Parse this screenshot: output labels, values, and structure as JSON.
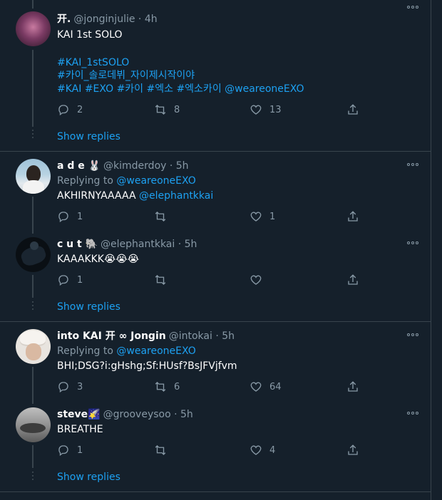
{
  "colors": {
    "background": "#15202b",
    "link": "#1da1f2",
    "muted": "#8899a6",
    "border": "#38444d"
  },
  "tweets": [
    {
      "name": "开.",
      "handle": "@jonginjulie",
      "time": "· 4h",
      "lines": [
        "KAI 1st SOLO",
        "#KAI_1stSOLO",
        "#카이_솔로데뷔_자이제시작이야",
        "#KAI #EXO #카이 #엑소 #엑소카이 @weareoneEXO"
      ],
      "replies": "2",
      "retweets": "8",
      "likes": "13"
    },
    {
      "name": "a d e 🐰",
      "handle": "@kimderdoy",
      "time": "· 5h",
      "replying_label": "Replying to",
      "replying_to": "@weareoneEXO",
      "text": "AKHIRNYAAAAA",
      "mention": "@elephantkkai",
      "replies": "1",
      "retweets": "",
      "likes": "1"
    },
    {
      "name": "c u t 🐘",
      "handle": "@elephantkkai",
      "time": "· 5h",
      "text": "KAAAKKK😭😭😭",
      "replies": "1",
      "retweets": "",
      "likes": ""
    },
    {
      "name": "into KAI 开 ∞ Jongin",
      "handle": "@intokai",
      "time": "· 5h",
      "replying_label": "Replying to",
      "replying_to": "@weareoneEXO",
      "text": "BHI;DSG?i:gHshg;Sf:HUsf?BsJFVjfvm",
      "replies": "3",
      "retweets": "6",
      "likes": "64"
    },
    {
      "name": "steve🌠",
      "handle": "@grooveysoo",
      "time": "· 5h",
      "text": "BREATHE",
      "replies": "1",
      "retweets": "",
      "likes": "4"
    }
  ],
  "show_replies_label": "Show replies"
}
